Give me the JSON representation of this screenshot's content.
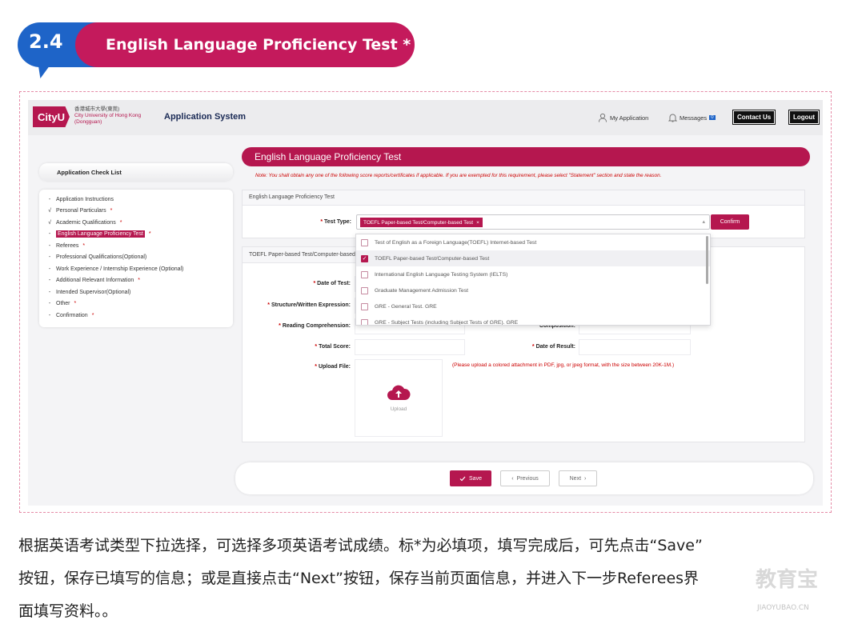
{
  "section": {
    "number": "2.4",
    "title": "English Language Proficiency Test *"
  },
  "app": {
    "logo_mark": "CityU",
    "logo_line1": "香港城市大學(東莞)",
    "logo_line2": "City University of Hong Kong",
    "logo_line3": "(Dongguan)",
    "title": "Application System",
    "my_application": "My Application",
    "messages": "Messages",
    "messages_count": "0",
    "contact_us": "Contact Us",
    "logout": "Logout"
  },
  "sidebar": {
    "header": "Application Check List",
    "items": [
      {
        "mark": "-",
        "label": "Application Instructions",
        "star": ""
      },
      {
        "mark": "√",
        "label": "Personal Particulars",
        "star": "*"
      },
      {
        "mark": "√",
        "label": "Academic Qualifications",
        "star": "*"
      },
      {
        "mark": "-",
        "label": "English Language Proficiency Test",
        "star": "*",
        "active": true
      },
      {
        "mark": "-",
        "label": "Referees",
        "star": "*"
      },
      {
        "mark": "-",
        "label": "Professional Qualifications(Optional)",
        "star": ""
      },
      {
        "mark": "-",
        "label": "Work Experience / Internship Experience (Optional)",
        "star": ""
      },
      {
        "mark": "-",
        "label": "Additional Relevant Information",
        "star": "*"
      },
      {
        "mark": "-",
        "label": "Intended Supervisor(Optional)",
        "star": ""
      },
      {
        "mark": "-",
        "label": "Other",
        "star": "*"
      },
      {
        "mark": "-",
        "label": "Confirmation",
        "star": "*"
      }
    ]
  },
  "main": {
    "heading": "English Language Proficiency Test",
    "note": "Note:  You shall obtain any one of the following score reports/certificates if applicable. If you are exempted for this requirement, please select  \"Statement\"  section and state the reason.",
    "card1_title": "English Language Proficiency Test",
    "test_type_label": "Test Type:",
    "selected_tag": "TOEFL Paper-based Test/Computer-based Test",
    "confirm": "Confirm",
    "card2_title": "TOEFL Paper-based Test/Computer-based Test",
    "date_of_test": "Date of Test:",
    "structure": "Structure/Written Expression:",
    "reading": "Reading Comprehension:",
    "composition": "Composition:",
    "total_score": "Total Score:",
    "date_of_result": "Date of Result:",
    "upload_file": "Upload File:",
    "upload_btn": "Upload",
    "upload_note": "(Please upload a colored attachment in PDF, jpg, or jpeg format, with the size between 20K-1M.)"
  },
  "dropdown": {
    "options": [
      {
        "label": "Test of English as a Foreign Language(TOEFL) Internet-based Test",
        "checked": false
      },
      {
        "label": "TOEFL Paper-based Test/Computer-based Test",
        "checked": true
      },
      {
        "label": "International English Language Testing System (IELTS)",
        "checked": false
      },
      {
        "label": "Graduate Management Admission Test",
        "checked": false
      },
      {
        "label": "GRE - General Test. GRE",
        "checked": false
      },
      {
        "label": "GRE - Subject Tests (including Subject Tests of GRE). GRE",
        "checked": false
      }
    ]
  },
  "footer_buttons": {
    "save": "Save",
    "previous": "Previous",
    "next": "Next"
  },
  "caption": {
    "line1": "根据英语考试类型下拉选择，可选择多项英语考试成绩。标*为必填项，填写完成后，可先点击“Save”",
    "line2": "按钮，保存已填写的信息；或是直接点击“Next”按钮，保存当前页面信息，并进入下一步Referees界",
    "line3": "面填写资料。。"
  },
  "watermark": {
    "main": "教育宝",
    "sub": "JIAOYUBAO.CN"
  },
  "colors": {
    "brand": "#b5174f",
    "section_blue": "#1e64c8",
    "section_pink": "#c41a5c"
  }
}
